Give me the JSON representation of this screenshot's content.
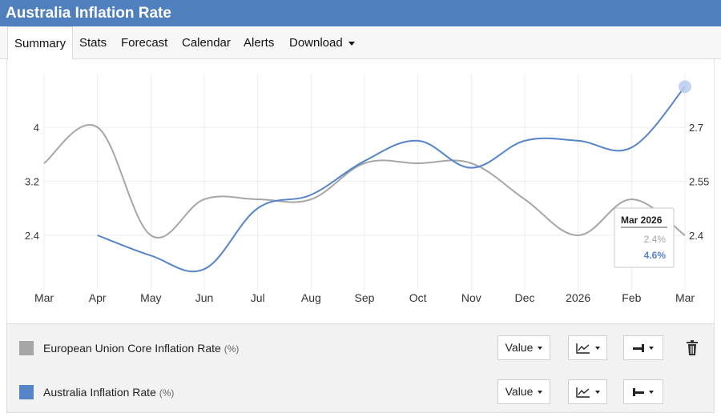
{
  "window": {
    "title": "Australia Inflation Rate"
  },
  "tabs": [
    {
      "label": "Summary",
      "active": true
    },
    {
      "label": "Stats"
    },
    {
      "label": "Forecast"
    },
    {
      "label": "Calendar"
    },
    {
      "label": "Alerts"
    },
    {
      "label": "Download",
      "dropdown": true
    }
  ],
  "colors": {
    "accent": "#4f7fbd",
    "eu_series": "#a6a6a6",
    "au_series": "#5584c8"
  },
  "chart_data": {
    "type": "line",
    "x": [
      "Mar",
      "Apr",
      "May",
      "Jun",
      "Jul",
      "Aug",
      "Sep",
      "Oct",
      "Nov",
      "Dec",
      "2026",
      "Feb",
      "Mar"
    ],
    "left_axis": {
      "ticks": [
        "2.4",
        "3.2",
        "4"
      ],
      "series": "Australia Inflation Rate"
    },
    "right_axis": {
      "ticks": [
        "2.4",
        "2.55",
        "2.7"
      ],
      "series": "European Union Core Inflation Rate"
    },
    "series": [
      {
        "name": "European Union Core Inflation Rate",
        "unit": "(%)",
        "axis": "right",
        "color": "#a6a6a6",
        "values": [
          2.6,
          2.7,
          2.4,
          2.5,
          2.5,
          2.5,
          2.6,
          2.6,
          2.6,
          2.5,
          2.4,
          2.5,
          2.4
        ]
      },
      {
        "name": "Australia Inflation Rate",
        "unit": "(%)",
        "axis": "left",
        "color": "#5584c8",
        "values": [
          null,
          2.4,
          2.1,
          1.9,
          2.8,
          3.0,
          3.5,
          3.8,
          3.4,
          3.8,
          3.8,
          3.7,
          4.6
        ]
      }
    ],
    "grid": true,
    "tooltip": {
      "title": "Mar 2026",
      "values": [
        "2.4%",
        "4.6%"
      ]
    }
  },
  "legend_controls": {
    "value_label": "Value",
    "trash_icon": "trash-icon",
    "chart_type_icon": "line-chart-icon",
    "axis_icons": [
      "right-axis-icon",
      "left-axis-icon"
    ]
  }
}
